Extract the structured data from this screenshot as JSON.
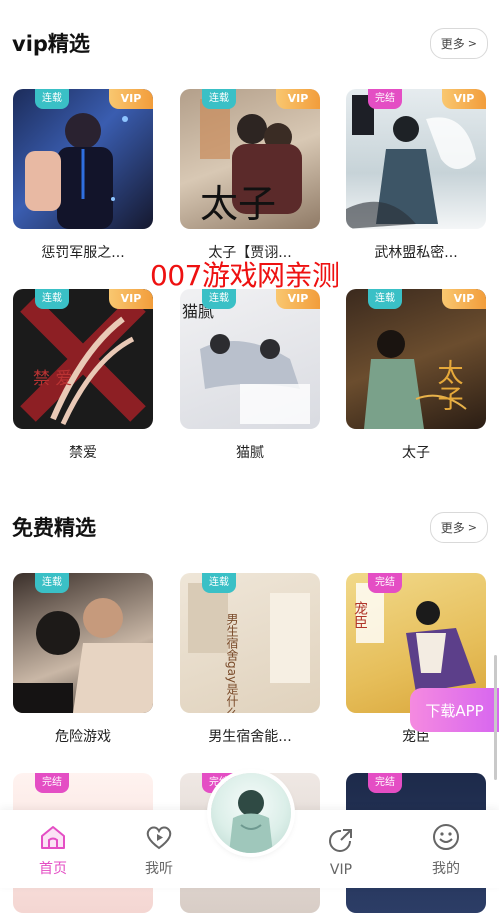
{
  "sections": {
    "vip": {
      "title": "vip精选",
      "more_label": "更多",
      "items": [
        {
          "title": "惩罚军服之...",
          "status": "连载",
          "vip": "VIP"
        },
        {
          "title": "太子【贾诩...",
          "status": "连载",
          "vip": "VIP"
        },
        {
          "title": "武林盟私密...",
          "status": "完结",
          "vip": "VIP"
        },
        {
          "title": "禁爱",
          "status": "连载",
          "vip": "VIP"
        },
        {
          "title": "猫腻",
          "status": "连载",
          "vip": "VIP"
        },
        {
          "title": "太子",
          "status": "连载",
          "vip": "VIP"
        }
      ]
    },
    "free": {
      "title": "免费精选",
      "more_label": "更多",
      "items": [
        {
          "title": "危险游戏",
          "status": "连载"
        },
        {
          "title": "男生宿舍能...",
          "status": "连载"
        },
        {
          "title": "宠臣",
          "status": "完结"
        },
        {
          "title": "",
          "status": "完结"
        },
        {
          "title": "",
          "status": "完结"
        },
        {
          "title": "",
          "status": "完结"
        }
      ]
    }
  },
  "cover_art": {
    "cover_1_text": "禁 爱",
    "cover_2_text": "太子",
    "cover_3_text": "猫腻",
    "cover_4_text": "太子",
    "cover_5_text": "男生宿舍gay是什么样子?",
    "cover_6_text": "宠臣"
  },
  "watermark": "007游戏网亲测",
  "download_label": "下载APP",
  "tabbar": {
    "tabs": [
      {
        "label": "首页",
        "icon": "home-icon",
        "active": true
      },
      {
        "label": "我听",
        "icon": "heart-play-icon",
        "active": false
      },
      {
        "label": "VIP",
        "icon": "share-arrow-icon",
        "active": false
      },
      {
        "label": "我的",
        "icon": "smile-icon",
        "active": false
      }
    ]
  },
  "colors": {
    "accent": "#e44ec4",
    "ongoing_tag": "#3ac0c6",
    "done_tag": "#e44ec4",
    "vip_tag": "#f29d3b"
  }
}
